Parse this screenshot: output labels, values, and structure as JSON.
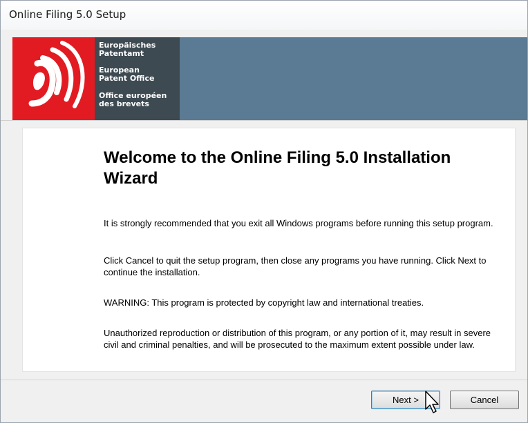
{
  "window": {
    "title": "Online Filing 5.0 Setup"
  },
  "header": {
    "logo_lines": [
      "Europäisches\nPatentamt",
      "European\nPatent Office",
      "Office européen\ndes brevets"
    ],
    "colors": {
      "red": "#e21b23",
      "dark": "#3e4a52",
      "banner": "#5b7a93"
    }
  },
  "main": {
    "heading": "Welcome to the Online Filing 5.0 Installation Wizard",
    "paragraphs": [
      "It is strongly recommended that you exit all Windows programs before running this setup program.",
      "Click Cancel to quit the setup program, then close any programs you have running.  Click Next to continue the installation.",
      "WARNING: This program is protected by copyright law and international treaties.",
      "Unauthorized reproduction or distribution of this program, or any portion of it, may result in severe civil and criminal penalties, and will be prosecuted to the maximum extent possible under law."
    ]
  },
  "footer": {
    "next_label": "Next >",
    "cancel_label": "Cancel"
  },
  "icons": [
    "epo-logo-icon",
    "mouse-cursor-icon"
  ]
}
